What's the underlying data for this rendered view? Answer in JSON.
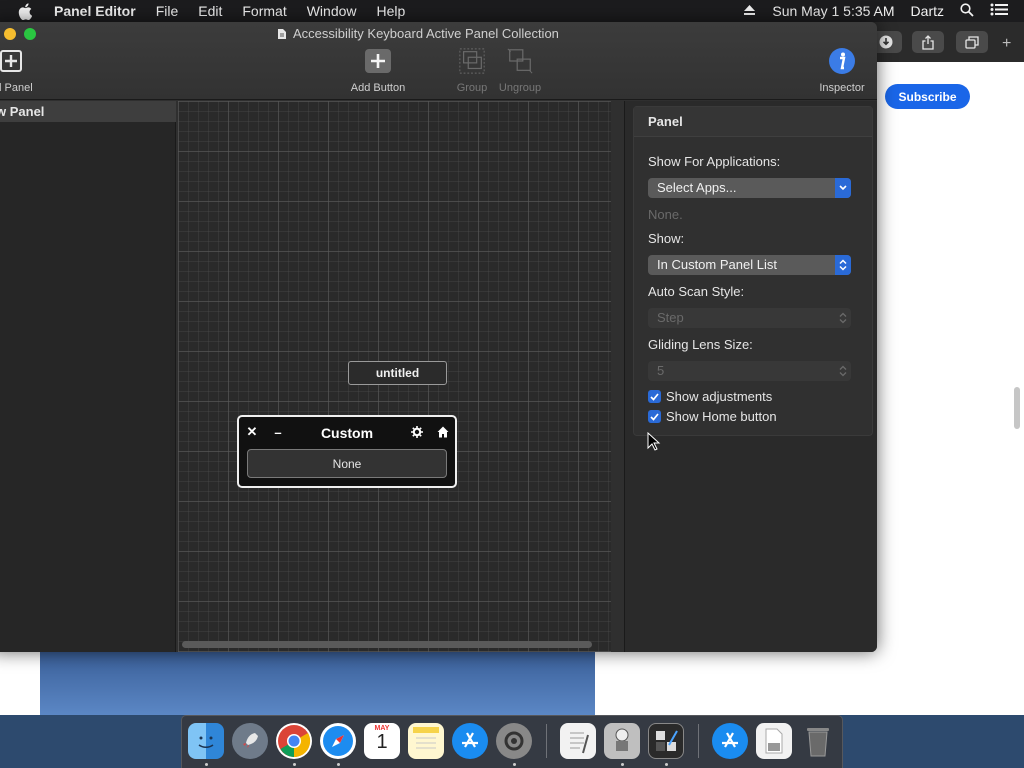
{
  "menubar": {
    "app_name": "Panel Editor",
    "items": [
      "File",
      "Edit",
      "Format",
      "Window",
      "Help"
    ],
    "date_time": "Sun May 1  5:35 AM",
    "user": "Dartz"
  },
  "window": {
    "title": "Accessibility Keyboard Active Panel Collection"
  },
  "toolbar": {
    "new_panel_label": "d Panel",
    "add_button_label": "Add Button",
    "group_label": "Group",
    "ungroup_label": "Ungroup",
    "inspector_label": "Inspector"
  },
  "sidebar": {
    "items": [
      {
        "label": "w Panel"
      }
    ]
  },
  "canvas": {
    "untitled_button": "untitled",
    "custom_panel": {
      "title": "Custom",
      "close_glyph": "✕",
      "minimize_glyph": "–",
      "button_label": "None"
    }
  },
  "inspector": {
    "header": "Panel",
    "show_for_apps_label": "Show For Applications:",
    "select_apps_value": "Select Apps...",
    "none_text": "None.",
    "show_label": "Show:",
    "show_value": "In Custom Panel List",
    "auto_scan_label": "Auto Scan Style:",
    "auto_scan_value": "Step",
    "gliding_lens_label": "Gliding Lens Size:",
    "gliding_lens_value": "5",
    "show_adjustments": {
      "label": "Show adjustments",
      "checked": true
    },
    "show_home": {
      "label": "Show Home button",
      "checked": true
    }
  },
  "browser": {
    "subscribe_label": "Subscribe",
    "new_tab_glyph": "+"
  },
  "dock": {
    "apps": [
      "Finder",
      "Launchpad",
      "Chrome",
      "Safari",
      "Calendar",
      "Notes",
      "App Store",
      "System Preferences",
      "TextEdit",
      "Automator",
      "Panel Editor",
      "App Store Downloads",
      "Document",
      "Trash"
    ],
    "calendar_month": "MAY",
    "calendar_day": "1"
  },
  "colors": {
    "accent": "#2a6ad7",
    "subscribe": "#1a66e8",
    "window_bg": "#2f2f2f"
  }
}
